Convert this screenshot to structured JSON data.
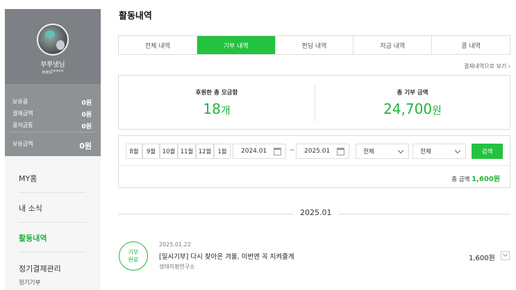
{
  "sidebar": {
    "profile": {
      "name": "부루넷님",
      "user_id": "east****"
    },
    "balances": [
      {
        "label": "보유콩",
        "value": "0원"
      },
      {
        "label": "결제금액",
        "value": "0원"
      },
      {
        "label": "콩저금통",
        "value": "0원"
      }
    ],
    "total": {
      "label": "보유금액",
      "value": "0원"
    },
    "menu": [
      {
        "label": "MY홈"
      },
      {
        "label": "내 소식"
      },
      {
        "label": "활동내역"
      },
      {
        "label": "정기결제관리"
      }
    ],
    "submenu": {
      "label": "정기기부"
    }
  },
  "main": {
    "title": "활동내역",
    "tabs": [
      {
        "label": "전체 내역"
      },
      {
        "label": "기부 내역"
      },
      {
        "label": "펀딩 내역"
      },
      {
        "label": "저금 내역"
      },
      {
        "label": "콩 내역"
      }
    ],
    "payment_link": "결제내역으로 보기",
    "stats": {
      "donated_count_label": "후원한 총 모금함",
      "donated_count": "18",
      "donated_count_unit": "개",
      "donated_total_label": "총 기부 금액",
      "donated_total": "24,700",
      "donated_total_unit": "원"
    },
    "filter": {
      "months": [
        "8월",
        "9월",
        "10월",
        "11월",
        "12월",
        "1월"
      ],
      "date_from": "2024.01",
      "date_sep": "~",
      "date_to": "2025.01",
      "select1": "전체",
      "select2": "전체",
      "search_label": "검색",
      "total_label": "총 금액",
      "total_amount": "1,600원"
    },
    "period": "2025.01",
    "entries": [
      {
        "badge_line1": "기부",
        "badge_line2": "완료",
        "date": "2025.01.22",
        "title": "[일시기부] 다시 찾아온 겨울, 이번엔 꼭 지켜줄게",
        "org": "생태지평연구소",
        "amount": "1,600원"
      }
    ]
  }
}
